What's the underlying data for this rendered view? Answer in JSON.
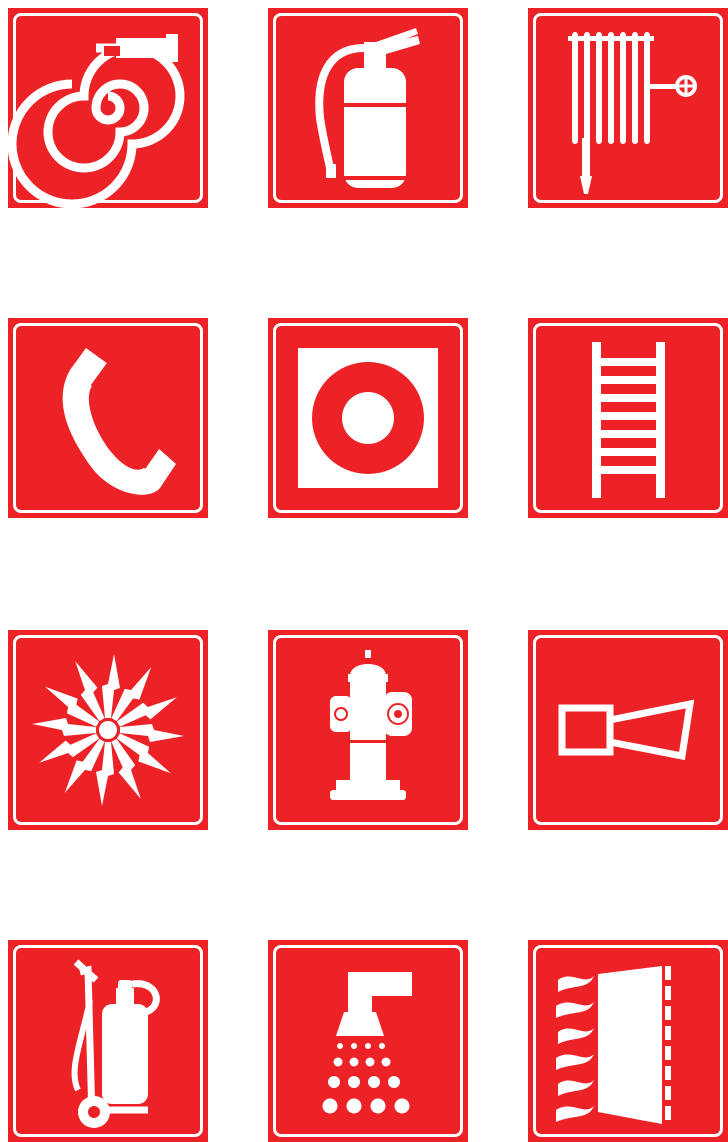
{
  "colors": {
    "sign_red": "#ec2227",
    "symbol_white": "#ffffff",
    "background": "#ffffff"
  },
  "signs": [
    {
      "icon": "fire-hose-reel-icon"
    },
    {
      "icon": "fire-extinguisher-icon"
    },
    {
      "icon": "fire-hose-rack-icon"
    },
    {
      "icon": "emergency-telephone-icon"
    },
    {
      "icon": "fire-alarm-call-point-icon"
    },
    {
      "icon": "fire-ladder-icon"
    },
    {
      "icon": "fire-alarm-activation-icon"
    },
    {
      "icon": "fire-hydrant-icon"
    },
    {
      "icon": "fire-alarm-horn-icon"
    },
    {
      "icon": "wheeled-fire-extinguisher-icon"
    },
    {
      "icon": "sprinkler-icon"
    },
    {
      "icon": "fire-door-icon"
    }
  ]
}
